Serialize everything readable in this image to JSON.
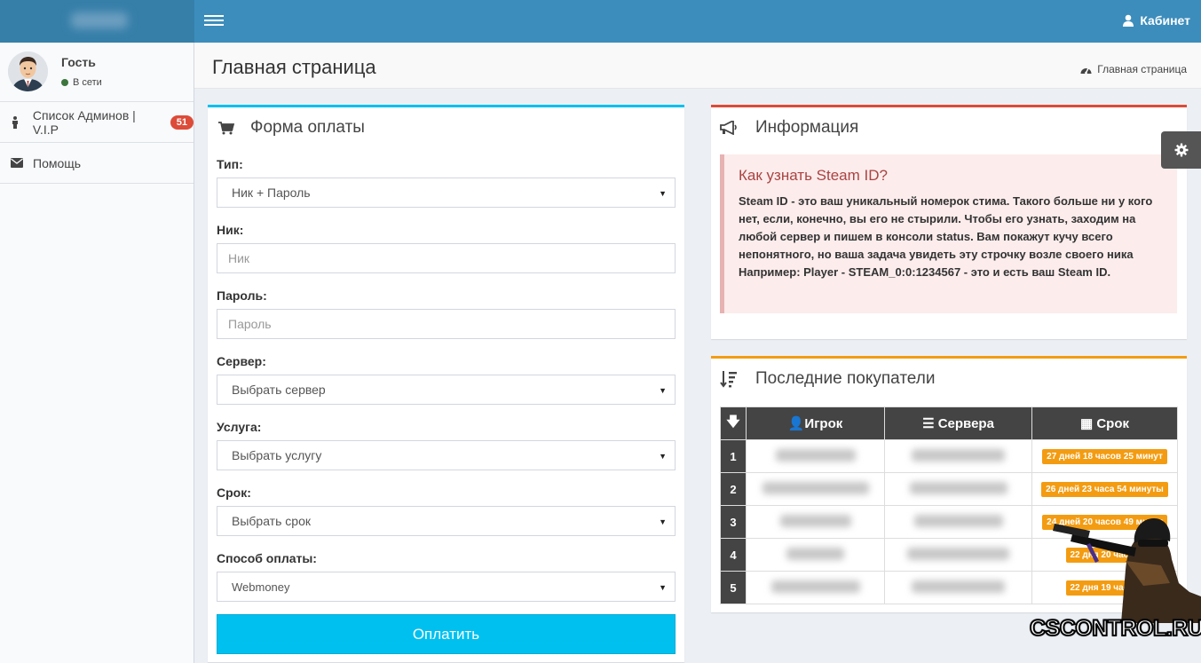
{
  "header": {
    "cabinet_label": "Кабинет"
  },
  "sidebar": {
    "user_name": "Гость",
    "user_status": "В сети",
    "items": [
      {
        "label": "Список Админов | V.I.P",
        "badge": "51"
      },
      {
        "label": "Помощь"
      }
    ]
  },
  "page": {
    "title": "Главная страница",
    "breadcrumb": "Главная страница"
  },
  "payment_form": {
    "title": "Форма оплаты",
    "type_label": "Тип:",
    "type_value": "Ник + Пароль",
    "nick_label": "Ник:",
    "nick_placeholder": "Ник",
    "password_label": "Пароль:",
    "password_placeholder": "Пароль",
    "server_label": "Сервер:",
    "server_value": "Выбрать сервер",
    "service_label": "Услуга:",
    "service_value": "Выбрать услугу",
    "term_label": "Срок:",
    "term_value": "Выбрать срок",
    "method_label": "Способ оплаты:",
    "method_value": "Webmoney",
    "submit_label": "Оплатить"
  },
  "info": {
    "title": "Информация",
    "callout_title": "Как узнать Steam ID?",
    "callout_text": "Steam ID - это ваш уникальный номерок стима. Такого больше ни у кого нет, если, конечно, вы его не стырили. Чтобы его узнать, заходим на любой сервер и пишем в консоли status. Вам покажут кучу всего непонятного, но ваша задача увидеть эту строчку возле своего ника Например: Player - STEAM_0:0:1234567 - это и есть ваш Steam ID."
  },
  "buyers": {
    "title": "Последние покупатели",
    "columns": [
      "Игрок",
      "Сервера",
      "Срок"
    ],
    "rows": [
      {
        "num": "1",
        "term": "27 дней 18 часов 25 минут"
      },
      {
        "num": "2",
        "term": "26 дней 23 часа 54 минуты"
      },
      {
        "num": "3",
        "term": "24 дней 20 часов 49 минут"
      },
      {
        "num": "4",
        "term": "22 дня 20 часов"
      },
      {
        "num": "5",
        "term": "22 дня 19 часов"
      }
    ]
  },
  "watermark": "CSCONTROL.RU",
  "colors": {
    "topbar": "#3c8dbc",
    "logo": "#367fa9",
    "form_box_border": "#00c0ef",
    "info_box_border": "#dd4b39",
    "buyers_box_border": "#f39c12",
    "pay_button": "#00c0ef",
    "badge": "#dd4b39",
    "term_badge": "#f39c12"
  }
}
